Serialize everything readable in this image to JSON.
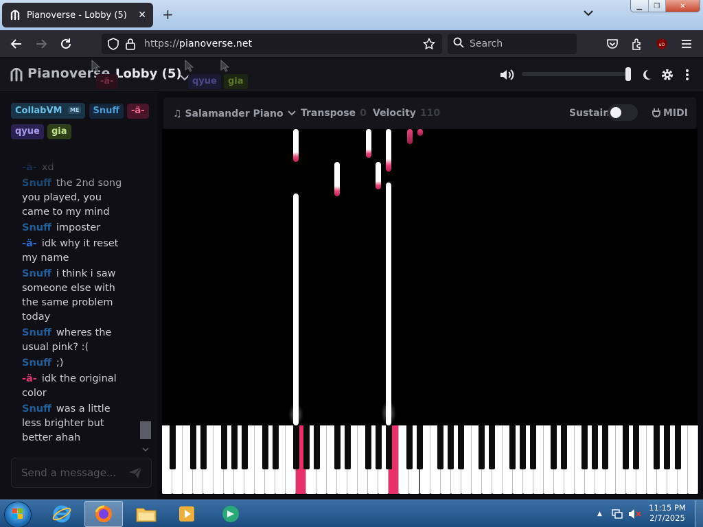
{
  "browser": {
    "tab_title": "Pianoverse - Lobby (5)",
    "url_scheme": "https://",
    "url_host": "pianoverse.net",
    "search_placeholder": "Search"
  },
  "app": {
    "brand": "Pianoverse",
    "room_title": "Lobby (5)",
    "header_cursors": [
      {
        "label": "-ä-",
        "color": "#d43a5e"
      },
      {
        "label": "qyue",
        "color": "#5a4fb0"
      },
      {
        "label": "gia",
        "color": "#7ea531"
      }
    ],
    "volume_level": 1.0
  },
  "users": [
    {
      "name": "CollabVM",
      "badge": "ME",
      "bg": "#1a3447",
      "fg": "#6cc1e8"
    },
    {
      "name": "Snuff",
      "bg": "#16263a",
      "fg": "#4a9bd6"
    },
    {
      "name": "-ä-",
      "bg": "#4a1529",
      "fg": "#f06b92"
    },
    {
      "name": "qyue",
      "bg": "#2a2150",
      "fg": "#a79cf0"
    },
    {
      "name": "gia",
      "bg": "#2e3e1a",
      "fg": "#c3e386"
    }
  ],
  "chat": [
    {
      "nick": "-ä-",
      "color": "#2b6cd1",
      "text": "xd"
    },
    {
      "nick": "Snuff",
      "color": "#215f9c",
      "text": "the 2nd song you played, you came to my mind"
    },
    {
      "nick": "Snuff",
      "color": "#215f9c",
      "text": "imposter"
    },
    {
      "nick": "-ä-",
      "color": "#2b6cd1",
      "text": "idk why it reset my name"
    },
    {
      "nick": "Snuff",
      "color": "#215f9c",
      "text": "i think i saw someone else with the same problem today"
    },
    {
      "nick": "Snuff",
      "color": "#215f9c",
      "text": "wheres the usual pink? :("
    },
    {
      "nick": "Snuff",
      "color": "#215f9c",
      "text": ";)"
    },
    {
      "nick": "-ä-",
      "color": "#e0386e",
      "text": "idk the original color"
    },
    {
      "nick": "Snuff",
      "color": "#215f9c",
      "text": "was a little less brighter but better ahah"
    }
  ],
  "message_placeholder": "Send a message...",
  "toolbar": {
    "instrument": "Salamander Piano",
    "transpose_label": "Transpose",
    "transpose_value": "0",
    "velocity_label": "Velocity",
    "velocity_value": "110",
    "sustain_label": "Sustain",
    "sustain_on": false,
    "midi_label": "MIDI"
  },
  "keyboard": {
    "white_key_count": 52,
    "pressed_color": "#e8306b"
  },
  "taskbar": {
    "time": "11:15 PM",
    "date": "2/7/2025"
  }
}
